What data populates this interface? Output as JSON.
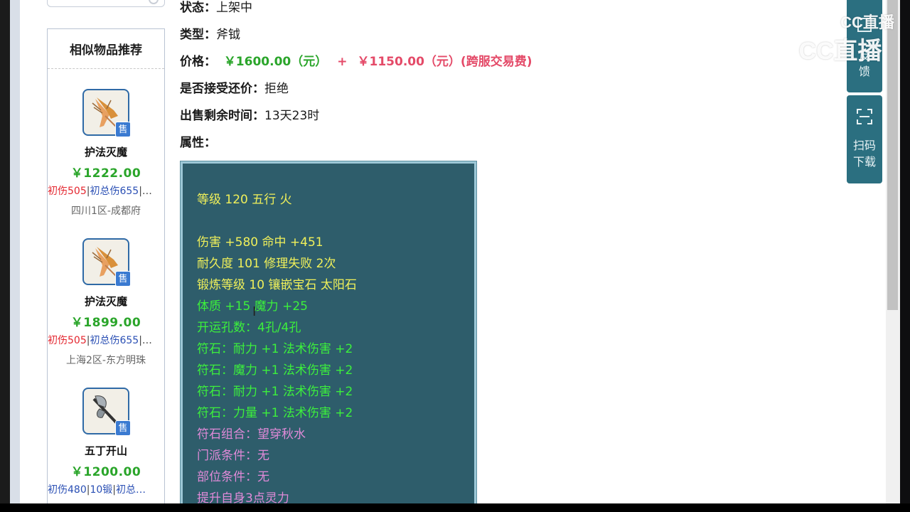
{
  "info": {
    "status_label": "状态：",
    "status_value": "上架中",
    "type_label": "类型：",
    "type_value": "斧钺",
    "price_label": "价格：",
    "price_main": "￥1600.00（元）",
    "price_plus": "+",
    "price_fee": "￥1150.00（元）(跨服交易费)",
    "counter_label": "是否接受还价：",
    "counter_value": "拒绝",
    "time_label": "出售剩余时间：",
    "time_value": "13天23时",
    "attr_label": "属性："
  },
  "attributes": [
    {
      "text": "等级 120 五行 火",
      "color": "yellow"
    },
    {
      "text": "",
      "color": "yellow"
    },
    {
      "text": "伤害 +580 命中 +451",
      "color": "yellow"
    },
    {
      "text": "耐久度 101 修理失败 2次",
      "color": "yellow"
    },
    {
      "text": "锻炼等级 10 镶嵌宝石 太阳石",
      "color": "yellow"
    },
    {
      "text": "体质 +15 魔力 +25",
      "color": "green"
    },
    {
      "text": "开运孔数：4孔/4孔",
      "color": "green"
    },
    {
      "text": "符石：耐力 +1 法术伤害 +2",
      "color": "green"
    },
    {
      "text": "符石：魔力 +1 法术伤害 +2",
      "color": "green"
    },
    {
      "text": "符石：耐力 +1 法术伤害 +2",
      "color": "green"
    },
    {
      "text": "符石：力量 +1 法术伤害 +2",
      "color": "green"
    },
    {
      "text": "符石组合：望穿秋水",
      "color": "purple"
    },
    {
      "text": "门派条件：无",
      "color": "purple"
    },
    {
      "text": "部位条件：无",
      "color": "purple"
    },
    {
      "text": "提升自身3点灵力",
      "color": "purple"
    }
  ],
  "sidebar": {
    "title": "相似物品推荐",
    "badge": "售",
    "items": [
      {
        "name": "护法灭魔",
        "price": "￥1222.00",
        "tag1": "初伤505",
        "tag2": "初总伤655",
        "more": "|…",
        "server": "四川1区-成都府",
        "icon": "shrimp-icon"
      },
      {
        "name": "护法灭魔",
        "price": "￥1899.00",
        "tag1": "初伤505",
        "tag2": "初总伤655",
        "more": "|…",
        "server": "上海2区-东方明珠",
        "icon": "shrimp-icon"
      },
      {
        "name": "五丁开山",
        "price": "￥1200.00",
        "tag1": "初伤480",
        "tag2": "10锻",
        "tag3": "初总…",
        "server": "",
        "icon": "axe-icon"
      }
    ]
  },
  "float_panel": {
    "feedback": [
      "反",
      "馈"
    ],
    "scan": [
      "扫码",
      "下载"
    ]
  },
  "watermark": {
    "small": "CC直播",
    "big": "CC直播"
  },
  "colors": {
    "price_green": "#2aa52a",
    "price_red": "#e44a68",
    "attr_bg": "#2e5d6b",
    "attr_yellow": "#f0f05a",
    "attr_green": "#3cf03c",
    "attr_purple": "#e08ad8",
    "panel": "#2b6f80"
  }
}
